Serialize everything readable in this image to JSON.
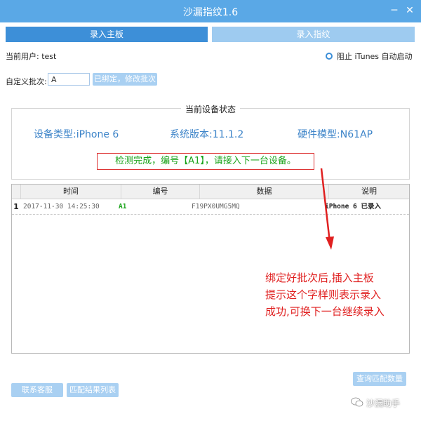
{
  "window": {
    "title": "沙漏指纹1.6",
    "minimize_glyph": "─",
    "close_glyph": "✕"
  },
  "tabs": [
    {
      "label": "录入主板"
    },
    {
      "label": "录入指纹"
    }
  ],
  "user": {
    "label": "当前用户:",
    "name": "test"
  },
  "itunes_option": {
    "label": "阻止 iTunes 自动启动"
  },
  "batch": {
    "label": "自定义批次:",
    "value": "A",
    "button": "已绑定，修改批次"
  },
  "device_status": {
    "title": "当前设备状态",
    "device_type": "设备类型:iPhone 6",
    "system_version": "系统版本:11.1.2",
    "hardware_model": "硬件模型:N61AP",
    "detect_message": "检测完成，编号【A1】，请接入下一台设备。"
  },
  "table": {
    "columns": [
      "时间",
      "编号",
      "数据",
      "说明"
    ],
    "rows": [
      {
        "num": "1",
        "time": "2017-11-30 14:25:30",
        "id": "A1",
        "data": "F19PX0UMG5MQ",
        "desc": "iPhone 6 已录入"
      }
    ]
  },
  "annotation": "绑定好批次后,插入主板\n提示这个字样则表示录入\n成功,可换下一台继续录入",
  "buttons": {
    "contact": "联系客服",
    "results": "匹配结果列表",
    "query": "查询匹配数量"
  },
  "watermark": "沙漏助手",
  "colors": {
    "titlebar": "#5aa8e6",
    "tab_active": "#3d8fd8",
    "tab_inactive": "#9ecbf0",
    "status_text": "#3b83c8",
    "success": "#19a319",
    "annotation": "#e02020"
  }
}
